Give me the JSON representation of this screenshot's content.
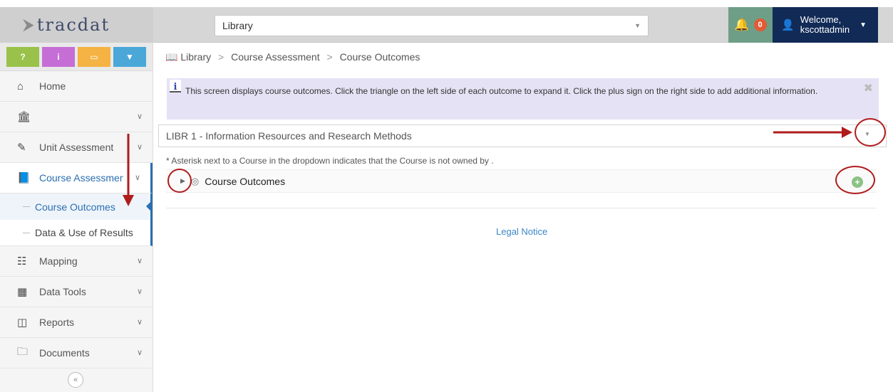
{
  "header": {
    "logo_text": "tracdat",
    "library_select": "Library",
    "notification_count": "0",
    "welcome": "Welcome,",
    "username": "kscottadmin"
  },
  "quick_buttons": [
    "?",
    "i",
    "▭",
    "▼"
  ],
  "sidebar": {
    "items": [
      {
        "label": "Home",
        "icon": "home-icon"
      },
      {
        "label": "",
        "icon": "institution-icon"
      },
      {
        "label": "Unit Assessment",
        "icon": "pencil-icon"
      },
      {
        "label": "Course Assessment",
        "icon": "book-icon"
      },
      {
        "label": "Mapping",
        "icon": "sitemap-icon"
      },
      {
        "label": "Data Tools",
        "icon": "table-icon"
      },
      {
        "label": "Reports",
        "icon": "columns-icon"
      },
      {
        "label": "Documents",
        "icon": "folder-icon"
      }
    ],
    "sub_items": [
      "Course Outcomes",
      "Data & Use of Results"
    ]
  },
  "breadcrumb": [
    "Library",
    "Course Assessment",
    "Course Outcomes"
  ],
  "info_message": "This screen displays course outcomes. Click the triangle on the left side of each outcome to expand it. Click the plus sign on the right side to add additional information.",
  "course_select": "LIBR 1 - Information Resources and Research Methods",
  "asterisk_note": "* Asterisk next to a Course in the dropdown indicates that the Course is not owned by .",
  "outcome_row_label": "Course Outcomes",
  "legal_notice": "Legal Notice",
  "colors": {
    "user_bar": "#112a56",
    "notification": "#6e9e87",
    "accent": "#2a6fb1",
    "annotation": "#b01c1c"
  }
}
